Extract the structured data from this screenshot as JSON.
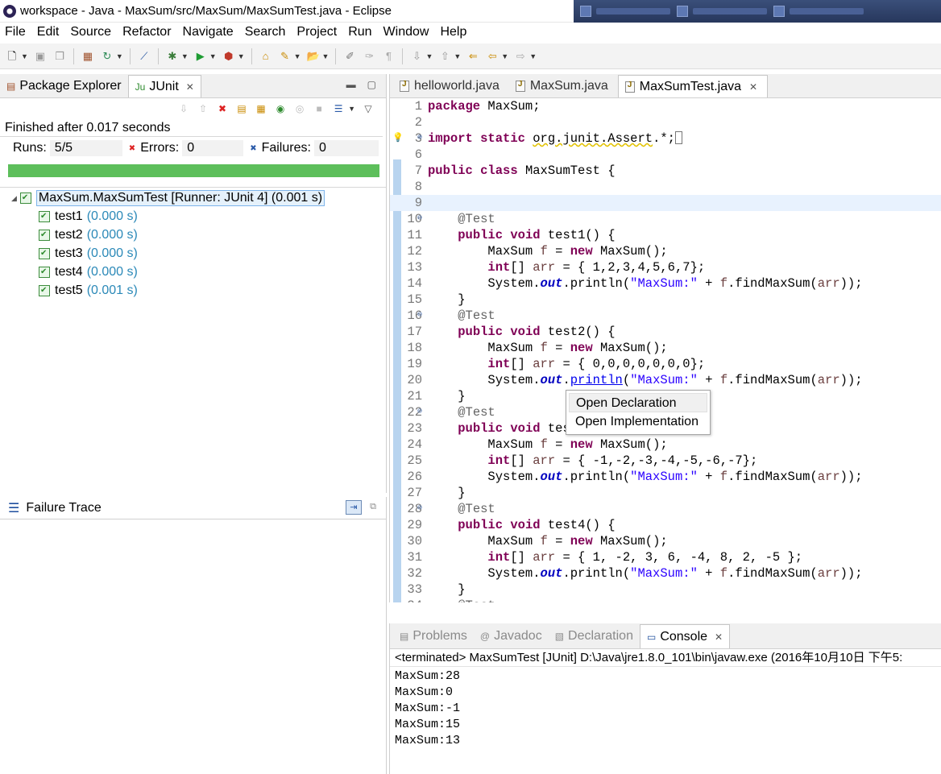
{
  "window": {
    "title": "workspace - Java - MaxSum/src/MaxSum/MaxSumTest.java - Eclipse"
  },
  "menu": [
    "File",
    "Edit",
    "Source",
    "Refactor",
    "Navigate",
    "Search",
    "Project",
    "Run",
    "Window",
    "Help"
  ],
  "left_view": {
    "tabs": [
      {
        "label": "Package Explorer"
      },
      {
        "label": "JUnit"
      }
    ],
    "status": "Finished after 0.017 seconds",
    "runs_label": "Runs:",
    "runs_value": "5/5",
    "errors_label": "Errors:",
    "errors_value": "0",
    "failures_label": "Failures:",
    "failures_value": "0",
    "progress_fraction": 1.0,
    "progress_color": "#5dbf5b",
    "root": "MaxSum.MaxSumTest [Runner: JUnit 4] (0.001 s)",
    "tests": [
      {
        "name": "test1",
        "time": "(0.000 s)"
      },
      {
        "name": "test2",
        "time": "(0.000 s)"
      },
      {
        "name": "test3",
        "time": "(0.000 s)"
      },
      {
        "name": "test4",
        "time": "(0.000 s)"
      },
      {
        "name": "test5",
        "time": "(0.001 s)"
      }
    ]
  },
  "failure_trace": {
    "title": "Failure Trace"
  },
  "editor": {
    "tabs": [
      "helloworld.java",
      "MaxSum.java",
      "MaxSumTest.java"
    ],
    "active_tab": "MaxSumTest.java",
    "line_numbers": [
      "1",
      "2",
      "3",
      "6",
      "7",
      "8",
      "9",
      "10",
      "11",
      "12",
      "13",
      "14",
      "15",
      "16",
      "17",
      "18",
      "19",
      "20",
      "21",
      "22",
      "23",
      "24",
      "25",
      "26",
      "27",
      "28",
      "29",
      "30",
      "31",
      "32",
      "33",
      "34"
    ],
    "popup": [
      "Open Declaration",
      "Open Implementation"
    ]
  },
  "bottom": {
    "tabs": [
      "Problems",
      "Javadoc",
      "Declaration",
      "Console"
    ],
    "active_tab": "Console",
    "console_header": "<terminated> MaxSumTest [JUnit] D:\\Java\\jre1.8.0_101\\bin\\javaw.exe (2016年10月10日 下午5:",
    "output": [
      "MaxSum:28",
      "MaxSum:0",
      "MaxSum:-1",
      "MaxSum:15",
      "MaxSum:13"
    ]
  }
}
